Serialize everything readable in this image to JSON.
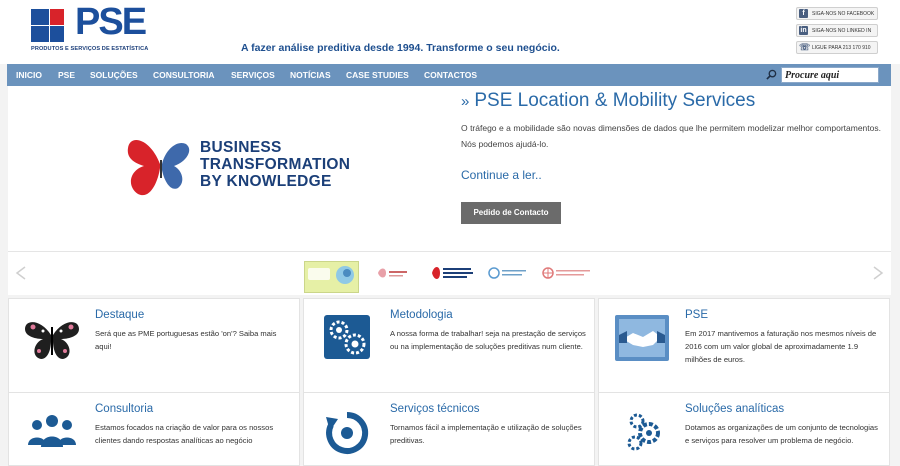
{
  "brand": {
    "name": "PSE",
    "subtitle": "PRODUTOS E SERVIÇOS DE ESTATÍSTICA",
    "tagline": "A fazer análise preditiva desde 1994. Transforme o seu negócio.",
    "color": "#1c4f9c"
  },
  "social": {
    "facebook": "SIGA-NOS NO FACEBOOK",
    "linkedin": "SIGA-NOS NO LINKED IN",
    "phone": "LIGUE PARA 213 170 910"
  },
  "nav": {
    "items": [
      "INICIO",
      "PSE",
      "SOLUÇÕES",
      "CONSULTORIA",
      "SERVIÇOS",
      "NOTÍCIAS",
      "CASE STUDIES",
      "CONTACTOS"
    ],
    "search_value": "Procure aqui",
    "bar_color": "#6b93bd"
  },
  "hero": {
    "logo_text": "BUSINESS\nTRANSFORMATION\nBY KNOWLEDGE",
    "arrow": "»",
    "title": "PSE Location & Mobility Services",
    "body": "O tráfego e a mobilidade são novas dimensões de dados que lhe permitem modelizar melhor comportamentos. Nós podemos ajudá-lo.",
    "link": "Continue a ler..",
    "cta": "Pedido de Contacto"
  },
  "cards": [
    {
      "title": "Destaque",
      "text": "Será que as PME portuguesas estão 'on'? Saiba mais aqui!",
      "icon": "butterfly-icon"
    },
    {
      "title": "Metodologia",
      "text": "A nossa forma de trabalhar! seja na prestação de serviços ou na implementação de soluções preditivas num cliente.",
      "icon": "gears-icon"
    },
    {
      "title": "PSE",
      "text": "Em 2017 mantivemos a faturação nos mesmos níveis de 2016 com um valor global de aproximadamente 1.9 milhões de euros.",
      "icon": "handshake-icon"
    },
    {
      "title": "Consultoria",
      "text": "Estamos focados na criação de valor para os nossos clientes dando respostas analíticas ao negócio",
      "icon": "people-icon"
    },
    {
      "title": "Serviços técnicos",
      "text": "Tornamos fácil a implementação e utilização de soluções preditivas.",
      "icon": "cycle-icon"
    },
    {
      "title": "Soluções analíticas",
      "text": "Dotamos as organizações de um conjunto de tecnologias e serviços para resolver um problema de negócio.",
      "icon": "cogs-icon"
    }
  ]
}
